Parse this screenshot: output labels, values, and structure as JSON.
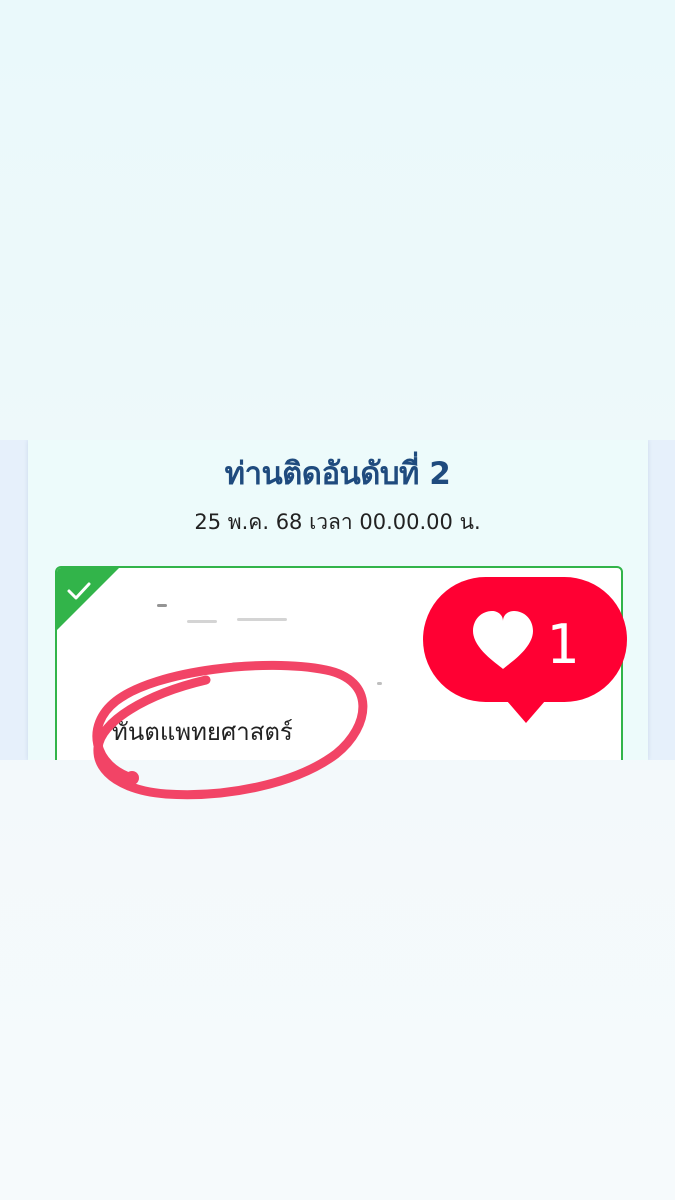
{
  "result": {
    "title": "ท่านติดอันดับที่ 2",
    "datetime": "25 พ.ค. 68 เวลา 00.00.00 น.",
    "faculty": "ทันตแพทยศาสตร์",
    "status_icon": "check-icon"
  },
  "sticker": {
    "icon": "heart-icon",
    "count": "1"
  },
  "colors": {
    "title": "#1f4b7e",
    "card_border": "#32b44a",
    "like_bg": "#ff0033",
    "annotation": "#f24466"
  }
}
